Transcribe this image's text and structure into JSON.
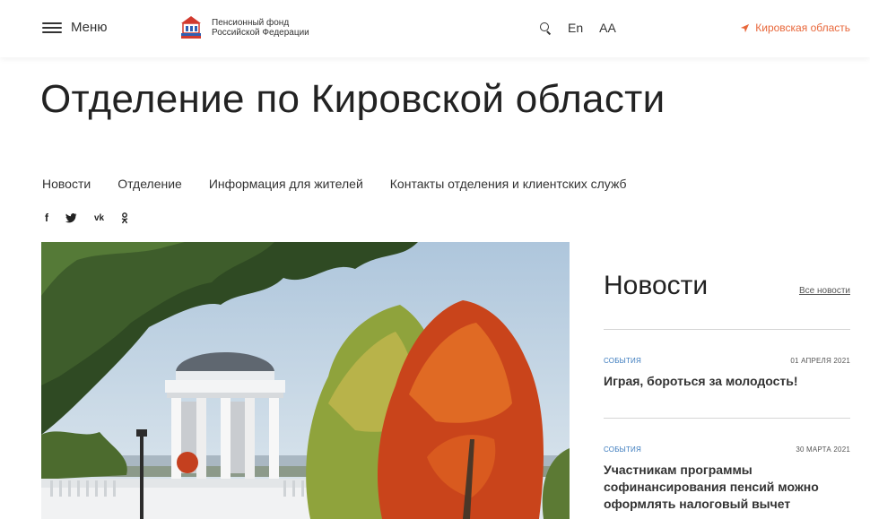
{
  "header": {
    "menu_label": "Меню",
    "logo_line1": "Пенсионный фонд",
    "logo_line2": "Российской Федерации",
    "lang": "En",
    "font_size": "AA",
    "region": "Кировская область"
  },
  "page": {
    "title": "Отделение по Кировской области"
  },
  "nav": {
    "items": [
      "Новости",
      "Отделение",
      "Информация для жителей",
      "Контакты отделения и клиентских служб"
    ]
  },
  "social": [
    "f",
    "🐦",
    "vk",
    "ok"
  ],
  "news": {
    "title": "Новости",
    "all_link": "Все новости",
    "items": [
      {
        "category": "события",
        "date": "01 апреля 2021",
        "text": "Играя, бороться за молодость!"
      },
      {
        "category": "события",
        "date": "30 марта 2021",
        "text": "Участникам программы софинансирования пенсий можно оформлять налоговый вычет"
      }
    ]
  },
  "colors": {
    "accent": "#e8673a",
    "category": "#3a7abd"
  }
}
